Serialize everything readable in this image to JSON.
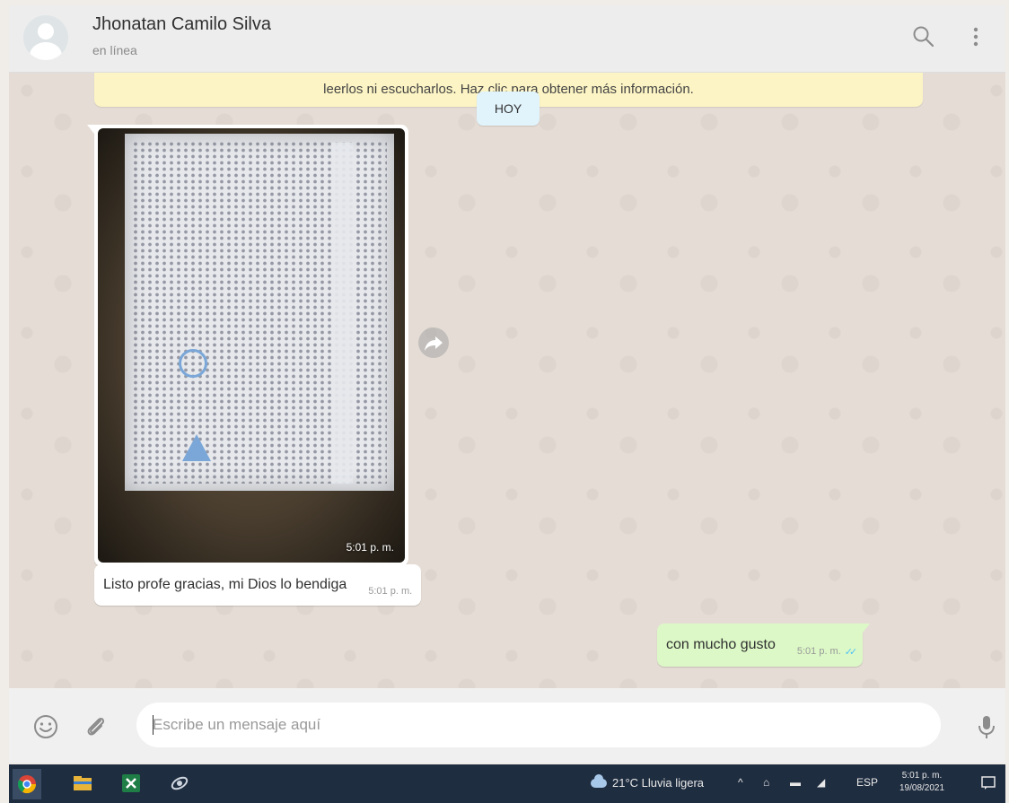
{
  "header": {
    "contact_name": "Jhonatan Camilo Silva",
    "status": "en línea"
  },
  "chat": {
    "notice_text": "leerlos ni escucharlos. Haz clic para obtener más información.",
    "date_chip": "HOY",
    "messages": [
      {
        "type": "image",
        "direction": "in",
        "time": "5:01 p. m."
      },
      {
        "type": "text",
        "direction": "in",
        "text": "Listo profe gracias, mi Dios lo bendiga",
        "time": "5:01 p. m."
      },
      {
        "type": "text",
        "direction": "out",
        "text": "con mucho gusto",
        "time": "5:01 p. m.",
        "status": "read"
      }
    ]
  },
  "compose": {
    "placeholder": "Escribe un mensaje aquí"
  },
  "taskbar": {
    "weather": "21°C Lluvia ligera",
    "language": "ESP",
    "clock_time": "5:01 p. m.",
    "clock_date": "19/08/2021"
  },
  "colors": {
    "outgoing_bubble": "#dcf8c6",
    "incoming_bubble": "#ffffff",
    "notice_bg": "#fcf4c4",
    "date_chip_bg": "#e1f3fb",
    "read_ticks": "#4fc3f7",
    "taskbar_bg": "#1f2d40"
  }
}
